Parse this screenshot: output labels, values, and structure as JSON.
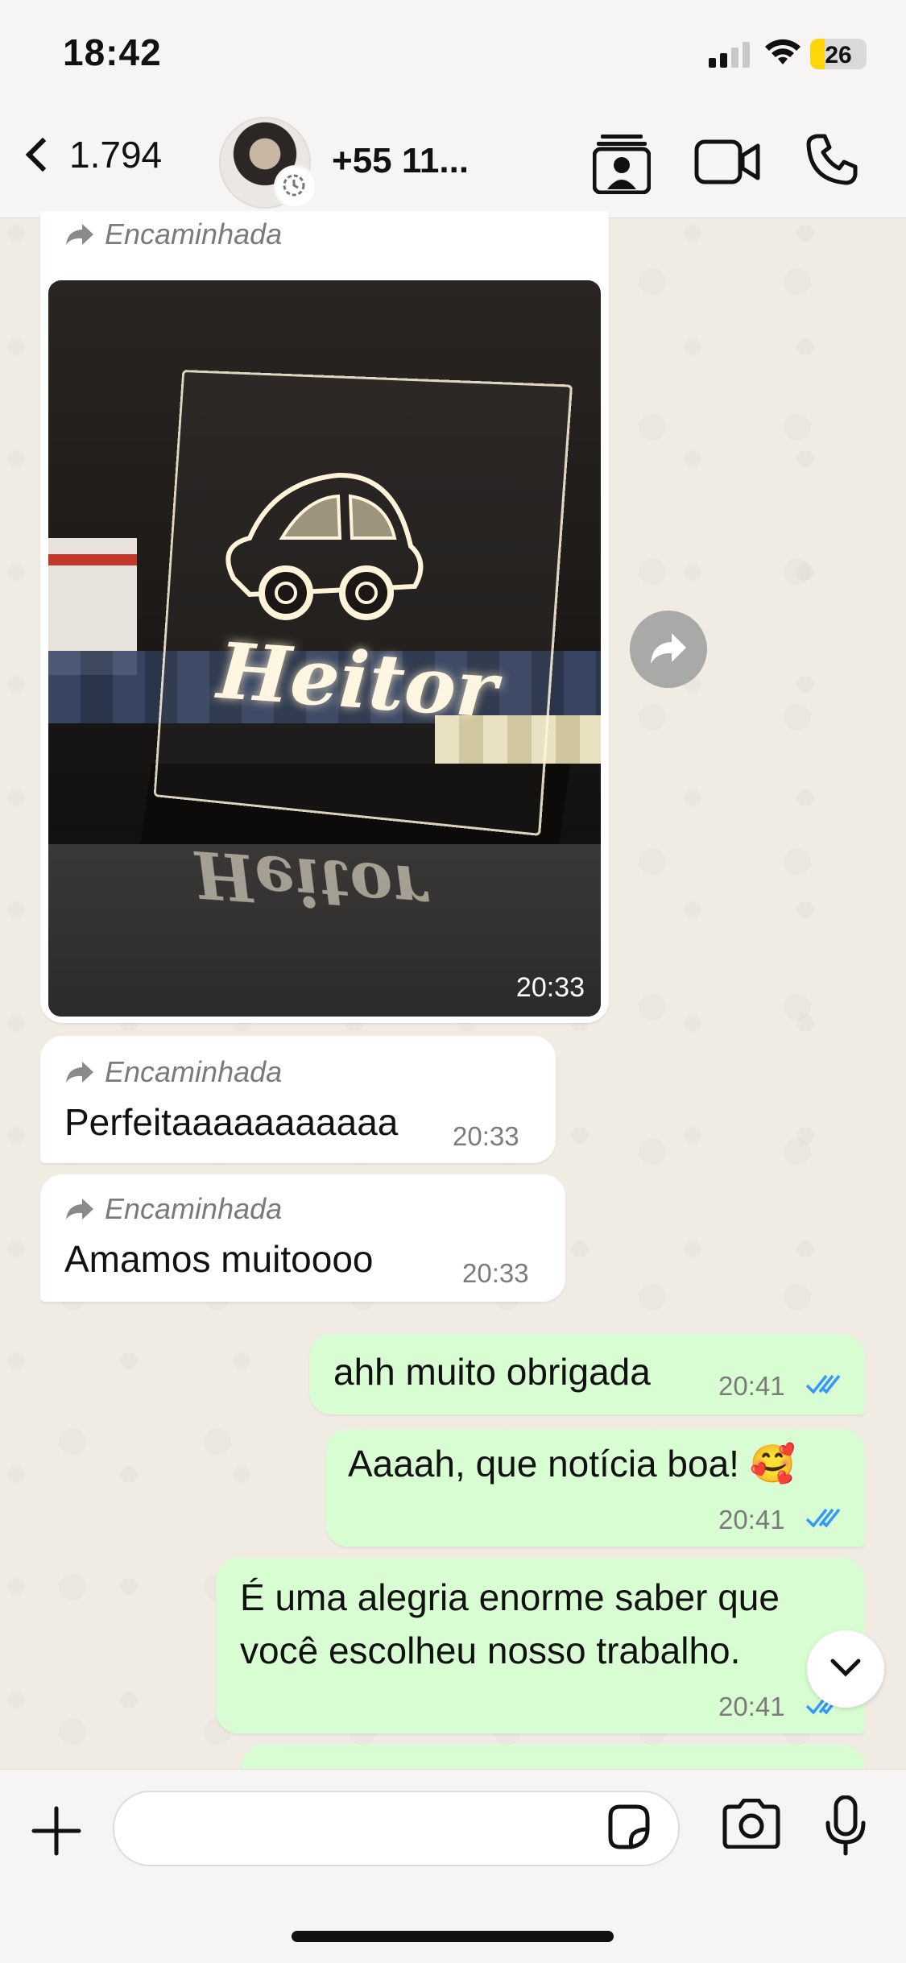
{
  "status_bar": {
    "time": "18:42",
    "battery": "26",
    "battery_level": 0.26
  },
  "header": {
    "back_count": "1.794",
    "contact_name": "+55 11...",
    "icons": [
      "back-chevron-icon",
      "contacts-icon",
      "video-call-icon",
      "phone-icon"
    ]
  },
  "messages": [
    {
      "direction": "in",
      "forwarded_label": "Encaminhada",
      "type": "image",
      "image_text": "Heitor",
      "time": "20:33"
    },
    {
      "direction": "in",
      "forwarded_label": "Encaminhada",
      "text": "Perfeitaaaaaaaaaaa",
      "time": "20:33"
    },
    {
      "direction": "in",
      "forwarded_label": "Encaminhada",
      "text": "Amamos muitoooo",
      "time": "20:33"
    },
    {
      "direction": "out",
      "text": "ahh muito obrigada",
      "time": "20:41",
      "status": "read"
    },
    {
      "direction": "out",
      "text": "Aaaah, que notícia boa! 🥰",
      "time": "20:41",
      "status": "read"
    },
    {
      "direction": "out",
      "line1": "É uma alegria enorme saber que",
      "line2": "você escolheu nosso trabalho.",
      "time": "20:41",
      "status": "read"
    }
  ],
  "colors": {
    "incoming": "#ffffff",
    "outgoing": "#d9fdd3",
    "read_ticks": "#3497f9",
    "wallpaper": "#efeae2"
  },
  "input_bar": {
    "value": "",
    "icons": [
      "plus-icon",
      "sticker-icon",
      "camera-icon",
      "mic-icon"
    ]
  }
}
